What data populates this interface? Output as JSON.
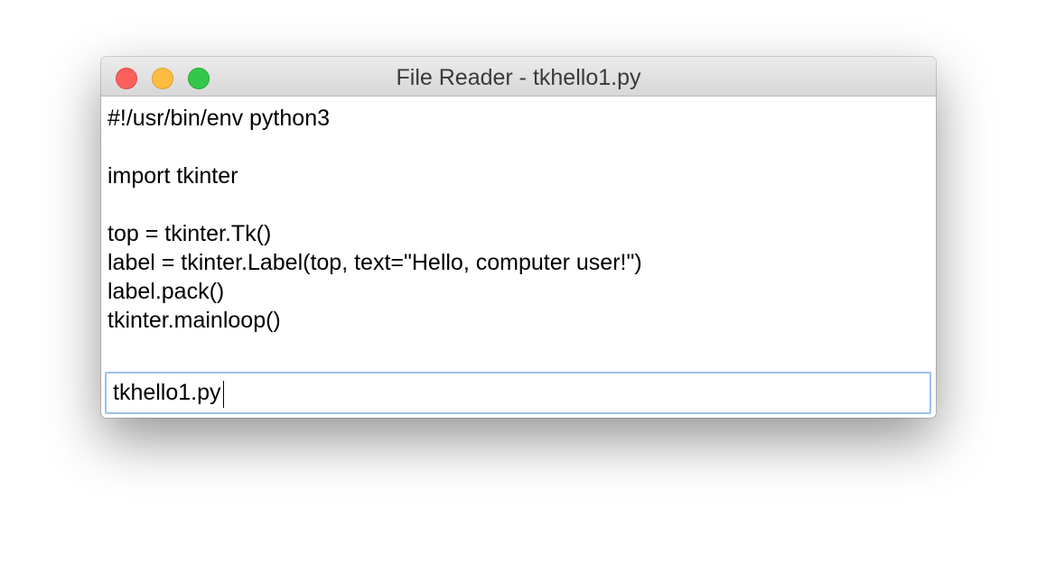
{
  "window": {
    "title": "File Reader - tkhello1.py"
  },
  "text_area": {
    "lines": [
      "#!/usr/bin/env python3",
      "",
      "import tkinter",
      "",
      "top = tkinter.Tk()",
      "label = tkinter.Label(top, text=\"Hello, computer user!\")",
      "label.pack()",
      "tkinter.mainloop()"
    ]
  },
  "filename_entry": {
    "value": "tkhello1.py"
  },
  "colors": {
    "close": "#fc605c",
    "minimize": "#fdbc40",
    "maximize": "#34c84a",
    "focus_ring": "#9ec2ee"
  }
}
